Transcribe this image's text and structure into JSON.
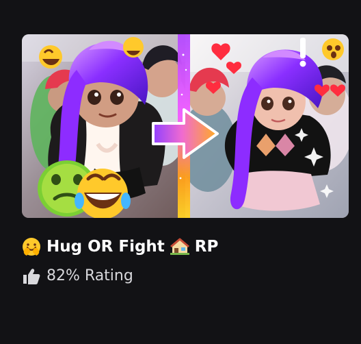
{
  "game": {
    "thumbnail_icon": "roblox-game-thumbnail-image",
    "title": "Hug OR Fight",
    "title_suffix": "RP",
    "title_prefix_icon": "hugging-face-icon",
    "title_house_icon": "house-icon",
    "rating": {
      "icon": "thumbs-up-icon",
      "text": "82% Rating",
      "value_percent": 82
    }
  },
  "colors": {
    "background": "#121215",
    "title_text": "#ffffff",
    "rating_text": "#d8d8dc",
    "accent_purple": "#8b39ff",
    "accent_orange": "#ff9f1a"
  }
}
